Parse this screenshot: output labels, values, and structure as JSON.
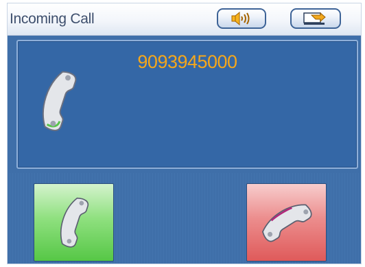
{
  "header": {
    "title": "Incoming Call"
  },
  "call": {
    "number": "9093945000"
  },
  "icons": {
    "speaker": "speaker-volume-icon",
    "exit": "exit-arrow-icon",
    "caller": "phone-handset-icon",
    "accept": "phone-handset-icon",
    "reject": "phone-handset-icon"
  },
  "colors": {
    "number": "#f5a71c",
    "accept": "#56c746",
    "reject": "#df5a5a",
    "panel": "#3467a6"
  }
}
